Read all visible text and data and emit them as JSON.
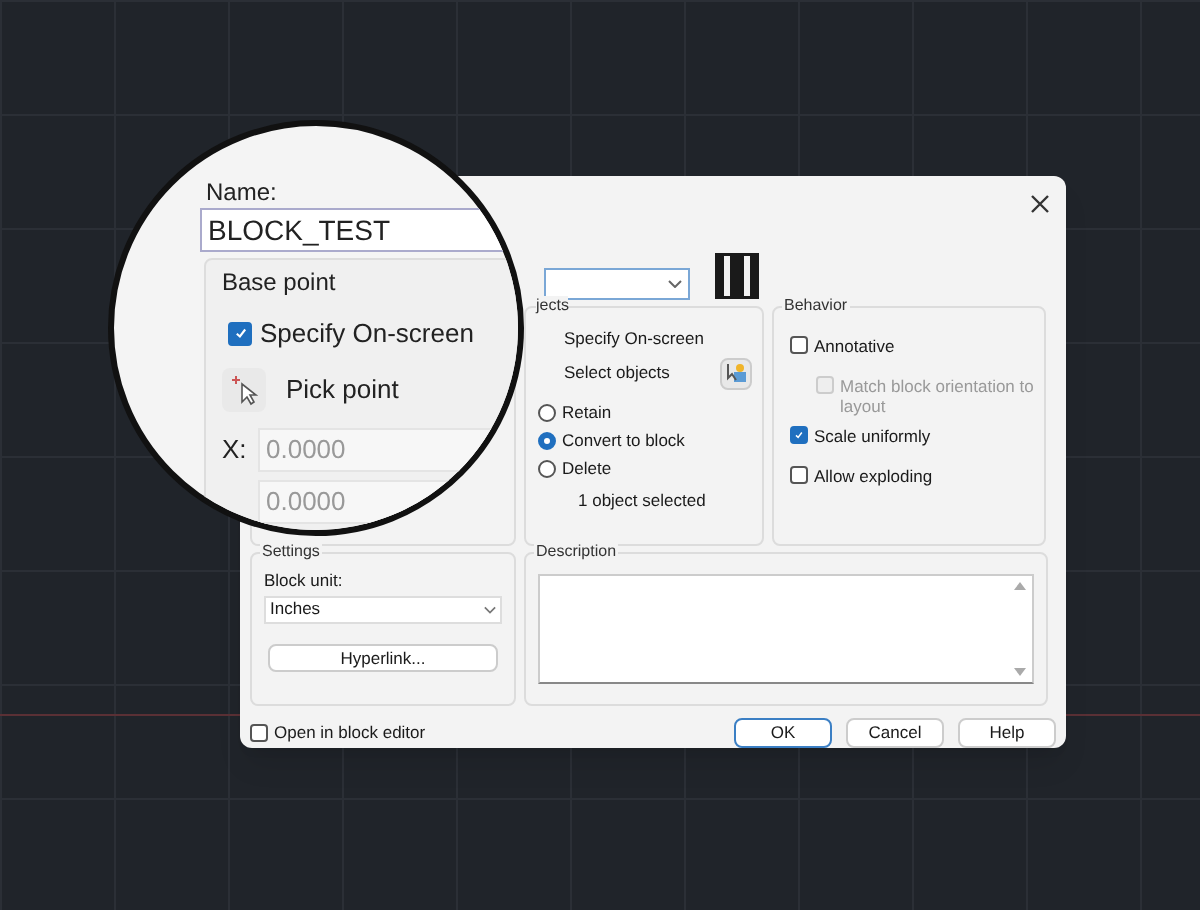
{
  "magnifier": {
    "name_label": "Name:",
    "name_value": "BLOCK_TEST",
    "base_point_title": "Base point",
    "specify_on_screen": {
      "label": "Specify On-screen",
      "checked": true
    },
    "pick_point": "Pick point",
    "x_label": "X:",
    "x_value": "0.0000",
    "y_value": "0.0000"
  },
  "objects": {
    "title": "jects",
    "specify_on_screen": "Specify On-screen",
    "select_objects": "Select objects",
    "options": [
      {
        "label": "Retain",
        "selected": false
      },
      {
        "label": "Convert to block",
        "selected": true
      },
      {
        "label": "Delete",
        "selected": false
      }
    ],
    "status": "1 object selected"
  },
  "behavior": {
    "title": "Behavior",
    "options": [
      {
        "label": "Annotative",
        "checked": false,
        "disabled": false,
        "indent": false
      },
      {
        "label": "Match block orientation to layout",
        "checked": false,
        "disabled": true,
        "indent": true
      },
      {
        "label": "Scale uniformly",
        "checked": true,
        "disabled": false,
        "indent": false
      },
      {
        "label": "Allow exploding",
        "checked": false,
        "disabled": false,
        "indent": false
      }
    ]
  },
  "settings": {
    "title": "Settings",
    "block_unit_label": "Block unit:",
    "block_unit_value": "Inches",
    "hyperlink": "Hyperlink..."
  },
  "description": {
    "title": "Description"
  },
  "open_in_block_editor": {
    "label": "Open in block editor",
    "checked": false
  },
  "buttons": [
    {
      "label": "OK",
      "default": true
    },
    {
      "label": "Cancel",
      "default": false
    },
    {
      "label": "Help",
      "default": false
    }
  ]
}
